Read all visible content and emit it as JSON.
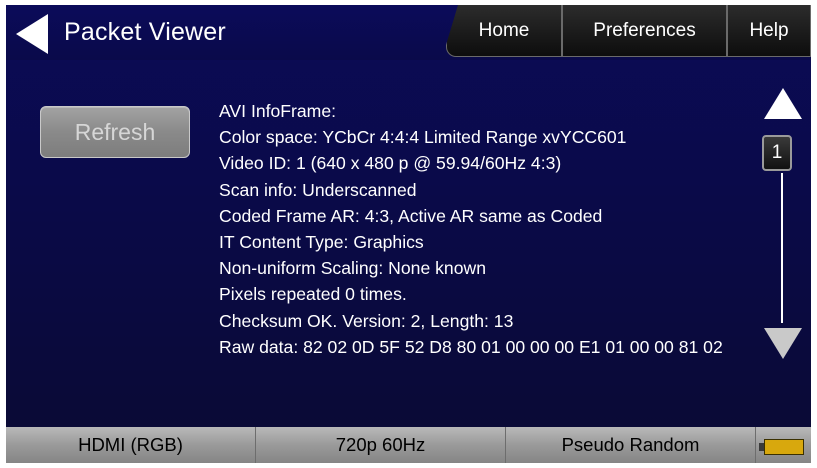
{
  "header": {
    "title": "Packet Viewer",
    "tabs": {
      "home": "Home",
      "preferences": "Preferences",
      "help": "Help"
    }
  },
  "refresh_label": "Refresh",
  "info_lines": {
    "l0": "AVI InfoFrame:",
    "l1": "Color space: YCbCr 4:4:4 Limited Range xvYCC601",
    "l2": "Video ID: 1 (640 x 480 p @ 59.94/60Hz 4:3)",
    "l3": "Scan info: Underscanned",
    "l4": "Coded Frame AR: 4:3, Active AR same as Coded",
    "l5": "IT Content Type: Graphics",
    "l6": "Non-uniform Scaling: None known",
    "l7": "Pixels repeated 0 times.",
    "l8": "Checksum OK. Version: 2, Length: 13",
    "l9": "Raw data: 82 02 0D 5F 52 D8 80 01 00 00 00 E1 01 00 00 81 02"
  },
  "scroll": {
    "page": "1",
    "up_icon": "triangle-up-icon",
    "down_icon": "triangle-down-icon"
  },
  "status_bar": {
    "interface": "HDMI (RGB)",
    "format": "720p 60Hz",
    "pattern": "Pseudo Random"
  },
  "colors": {
    "background": "#0a0a4a",
    "button_disabled": "#8a8a8a",
    "status_bar": "#9a9a9a",
    "battery": "#d8a80d"
  }
}
